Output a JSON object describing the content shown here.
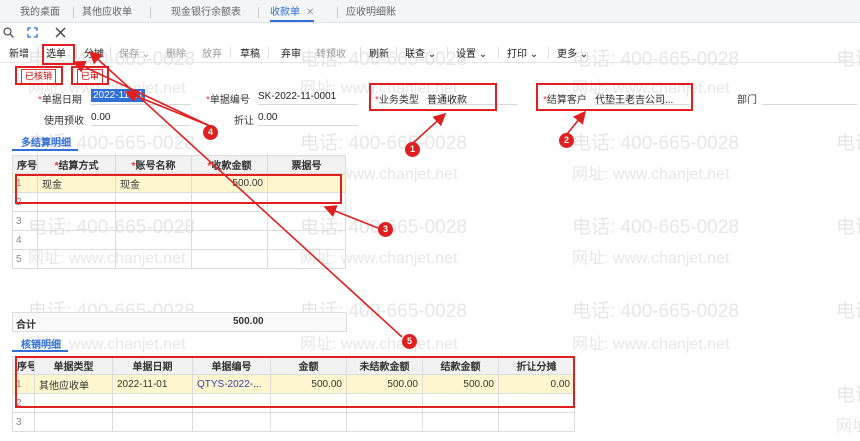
{
  "tabs": [
    {
      "label": "我的桌面"
    },
    {
      "label": "其他应收单"
    },
    {
      "label": "现金银行余额表"
    },
    {
      "label": "收款单",
      "active": true
    },
    {
      "label": "应收明细账"
    }
  ],
  "toolbar": {
    "new": "新增",
    "select": "选单",
    "split": "分摊",
    "save": "保存",
    "delete": "删除",
    "abandon": "放弃",
    "draft": "草稿",
    "unaudit": "弃审",
    "to_prepay": "转预收",
    "refresh": "刷新",
    "related_query": "联查",
    "settings": "设置",
    "print": "打印",
    "more": "更多"
  },
  "stamps": {
    "written_off": "已核销",
    "audited": "已审"
  },
  "form": {
    "date_label": "单据日期",
    "date_value": "2022-11-01",
    "number_label": "单据编号",
    "number_value": "SK-2022-11-0001",
    "biz_type_label": "业务类型",
    "biz_type_value": "普通收款",
    "customer_label": "结算客户",
    "customer_value": "代垫王老吉公司...",
    "dept_label": "部门",
    "prepay_label": "使用预收",
    "prepay_value": "0.00",
    "discount_label": "折让",
    "discount_value": "0.00"
  },
  "settle_section": {
    "title": "多结算明细"
  },
  "settle_table": {
    "headers": [
      "序号",
      "结算方式",
      "账号名称",
      "收款金额",
      "票据号"
    ],
    "rows": [
      [
        "1",
        "现金",
        "现金",
        "500.00",
        ""
      ],
      [
        "2",
        "",
        "",
        "",
        ""
      ],
      [
        "3",
        "",
        "",
        "",
        ""
      ],
      [
        "4",
        "",
        "",
        "",
        ""
      ],
      [
        "5",
        "",
        "",
        "",
        ""
      ]
    ]
  },
  "total": {
    "label": "合计",
    "value": "500.00"
  },
  "writeoff_section": {
    "title": "核销明细"
  },
  "writeoff_table": {
    "headers": [
      "序号",
      "单据类型",
      "单据日期",
      "单据编号",
      "金额",
      "未结款金额",
      "结款金额",
      "折让分摊"
    ],
    "rows": [
      [
        "1",
        "其他应收单",
        "2022-11-01",
        "QTYS-2022-...",
        "500.00",
        "500.00",
        "500.00",
        "0.00"
      ],
      [
        "2",
        "",
        "",
        "",
        "",
        "",
        "",
        ""
      ],
      [
        "3",
        "",
        "",
        "",
        "",
        "",
        "",
        ""
      ]
    ]
  },
  "annotations": [
    "1",
    "2",
    "3",
    "4",
    "5"
  ],
  "watermark": {
    "phone": "电话: 400-665-0028",
    "site": "网址: www.chanjet.net"
  },
  "colors": {
    "accent": "#2f6fd6",
    "annotation": "#e02020",
    "selected_row": "#fdf6cf"
  }
}
